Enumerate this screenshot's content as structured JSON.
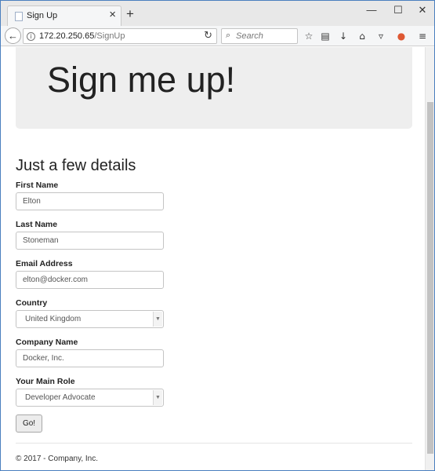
{
  "browser": {
    "tab_title": "Sign Up",
    "tab_close": "×",
    "new_tab": "+",
    "window_controls": {
      "minimize": "—",
      "maximize": "☐",
      "close": "✕"
    },
    "url_host": "172.20.250.65",
    "url_path": "/SignUp",
    "search_placeholder": "Search",
    "toolbar_icons": [
      "star-icon",
      "clipboard-icon",
      "download-icon",
      "home-icon",
      "pocket-icon",
      "extension-icon",
      "menu-icon"
    ]
  },
  "page": {
    "jumbotron_title": "Sign me up!",
    "section_title": "Just a few details",
    "fields": [
      {
        "label": "First Name",
        "value": "Elton"
      },
      {
        "label": "Last Name",
        "value": "Stoneman"
      },
      {
        "label": "Email Address",
        "value": "elton@docker.com"
      },
      {
        "label": "Country",
        "value": "United Kingdom"
      },
      {
        "label": "Company Name",
        "value": "Docker, Inc."
      },
      {
        "label": "Your Main Role",
        "value": "Developer Advocate"
      }
    ],
    "submit_label": "Go!",
    "footer": "© 2017 - Company, Inc."
  }
}
